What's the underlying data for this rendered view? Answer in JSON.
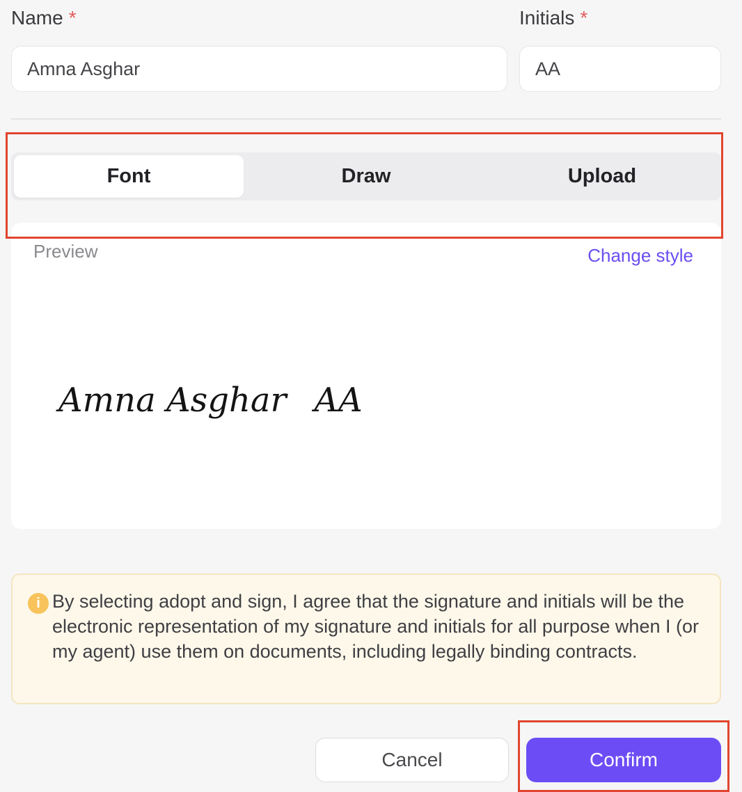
{
  "form": {
    "name_label": "Name",
    "name_value": "Amna Asghar",
    "initials_label": "Initials",
    "initials_value": "AA",
    "required_mark": "*"
  },
  "tabs": [
    {
      "label": "Font",
      "active": true
    },
    {
      "label": "Draw",
      "active": false
    },
    {
      "label": "Upload",
      "active": false
    }
  ],
  "preview": {
    "label": "Preview",
    "change_style_label": "Change style",
    "signature_text": "Amna Asghar",
    "initials_text": "AA"
  },
  "notice": {
    "icon": "info-icon",
    "text": "By selecting adopt and sign, I agree that the signature and initials will be the electronic representation of my signature and initials for all purpose when I (or my agent) use them on documents, including legally binding contracts."
  },
  "buttons": {
    "cancel_label": "Cancel",
    "confirm_label": "Confirm"
  },
  "colors": {
    "accent": "#6c4df5",
    "highlight": "#e2452f",
    "required": "#e05b5b",
    "notice_bg": "#fdf8ea",
    "info_icon": "#f7c35a"
  }
}
